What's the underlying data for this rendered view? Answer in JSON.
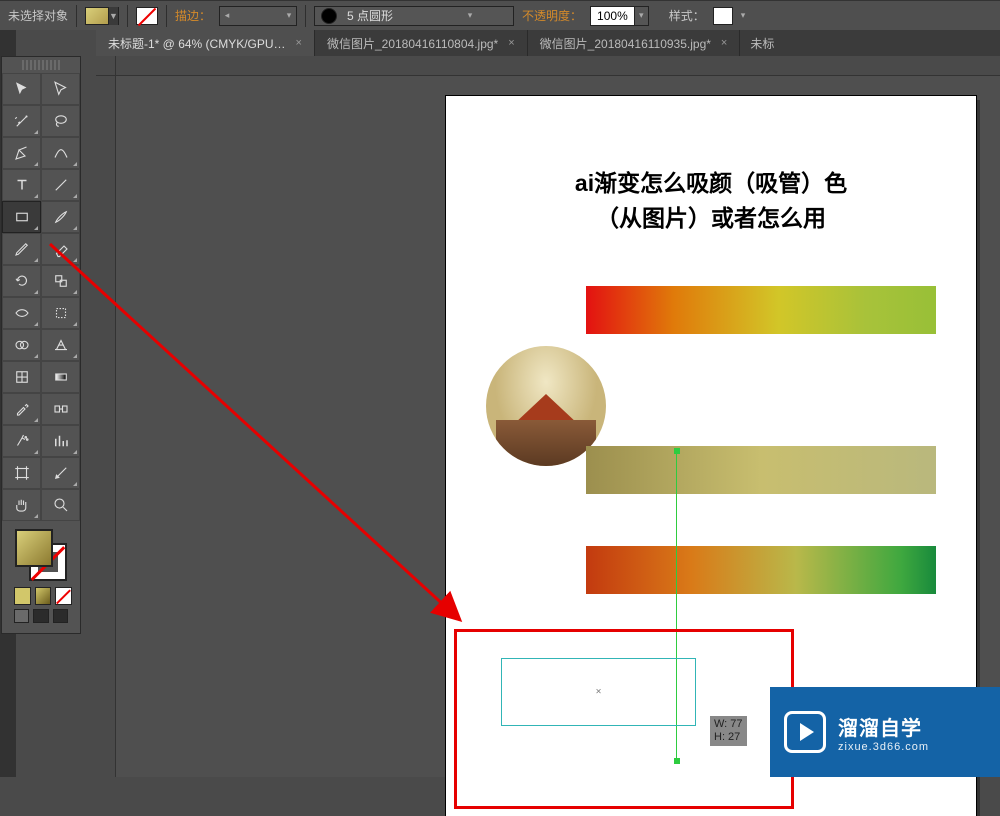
{
  "options_bar": {
    "selection_state": "未选择对象",
    "stroke_label": "描边：",
    "stroke_weight": "",
    "brush_value": "5 点圆形",
    "opacity_label": "不透明度：",
    "opacity_value": "100%",
    "style_label": "样式："
  },
  "tabs": [
    {
      "label": "未标题-1* @ 64% (CMYK/GPU…",
      "active": true
    },
    {
      "label": "微信图片_20180416110804.jpg*",
      "active": false
    },
    {
      "label": "微信图片_20180416110935.jpg*",
      "active": false
    }
  ],
  "tabs_overflow": "未标",
  "artboard": {
    "title_line1": "ai渐变怎么吸颜（吸管）色",
    "title_line2": "（从图片）或者怎么用",
    "measure": "W: 77\nH: 27"
  },
  "tools": {
    "row0": [
      "selection-tool",
      "direct-selection-tool"
    ],
    "row1": [
      "magic-wand-tool",
      "lasso-tool"
    ],
    "row2": [
      "pen-tool",
      "curvature-tool"
    ],
    "row3": [
      "type-tool",
      "line-tool"
    ],
    "row4": [
      "rectangle-tool",
      "paintbrush-tool"
    ],
    "row5": [
      "pencil-tool",
      "eraser-tool"
    ],
    "row6": [
      "rotate-tool",
      "scale-tool"
    ],
    "row7": [
      "width-tool",
      "free-transform-tool"
    ],
    "row8": [
      "shape-builder-tool",
      "perspective-tool"
    ],
    "row9": [
      "mesh-tool",
      "gradient-tool"
    ],
    "row10": [
      "eyedropper-tool",
      "blend-tool"
    ],
    "row11": [
      "symbol-sprayer-tool",
      "column-graph-tool"
    ],
    "row12": [
      "artboard-tool",
      "slice-tool"
    ],
    "row13": [
      "hand-tool",
      "zoom-tool"
    ]
  },
  "watermark": {
    "title": "溜溜自学",
    "url": "zixue.3d66.com"
  }
}
